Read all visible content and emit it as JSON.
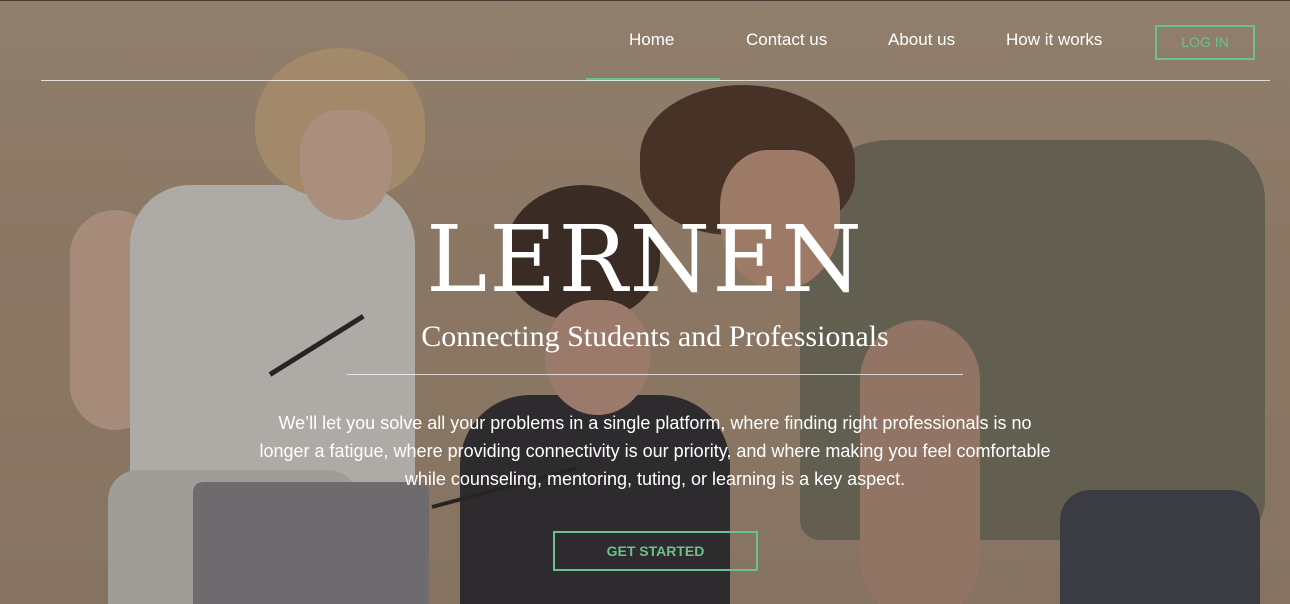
{
  "nav": {
    "items": [
      {
        "label": "Home",
        "active": true
      },
      {
        "label": "Contact us",
        "active": false
      },
      {
        "label": "About us",
        "active": false
      },
      {
        "label": "How it works",
        "active": false
      }
    ],
    "login_label": "LOG IN"
  },
  "hero": {
    "title": "LERNEN",
    "tagline": "Connecting Students and Professionals",
    "description": "We’ll let you solve all your problems in a single platform, where finding right professionals is no longer a fatigue, where providing connectivity is our priority, and where making you feel comfortable while counseling, mentoring, tuting, or learning is a key aspect.",
    "cta_label": "GET STARTED"
  },
  "colors": {
    "accent": "#6cc08a",
    "text": "#ffffff",
    "background": "#a08c78"
  }
}
